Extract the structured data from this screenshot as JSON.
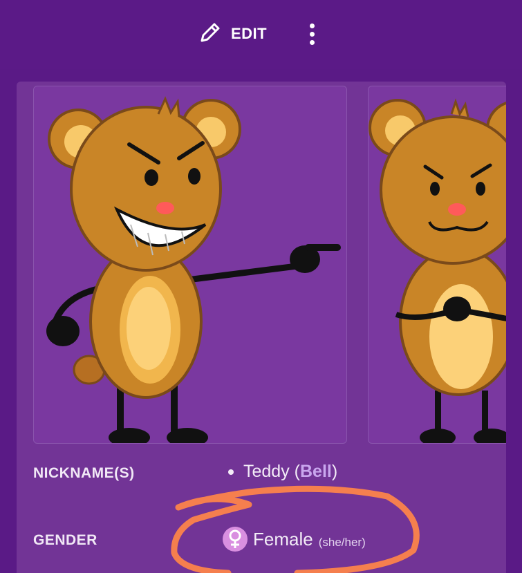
{
  "toolbar": {
    "edit_label": "EDIT",
    "edit_icon": "pencil-icon",
    "more_icon": "more-vertical-icon"
  },
  "infobox": {
    "gallery": [
      {
        "name": "teddy-pointing-image"
      },
      {
        "name": "teddy-arms-crossed-image"
      }
    ],
    "nickname": {
      "label": "NICKNAME(S)",
      "prefix": "Teddy (",
      "link": "Bell",
      "suffix": ")"
    },
    "gender": {
      "label": "GENDER",
      "icon": "female-symbol-icon",
      "value": "Female",
      "pronouns": "(she/her)"
    }
  },
  "colors": {
    "topbar": "#5b1a87",
    "panel": "#723496",
    "link": "#c9a6ee",
    "annotation": "#f57f4e"
  }
}
